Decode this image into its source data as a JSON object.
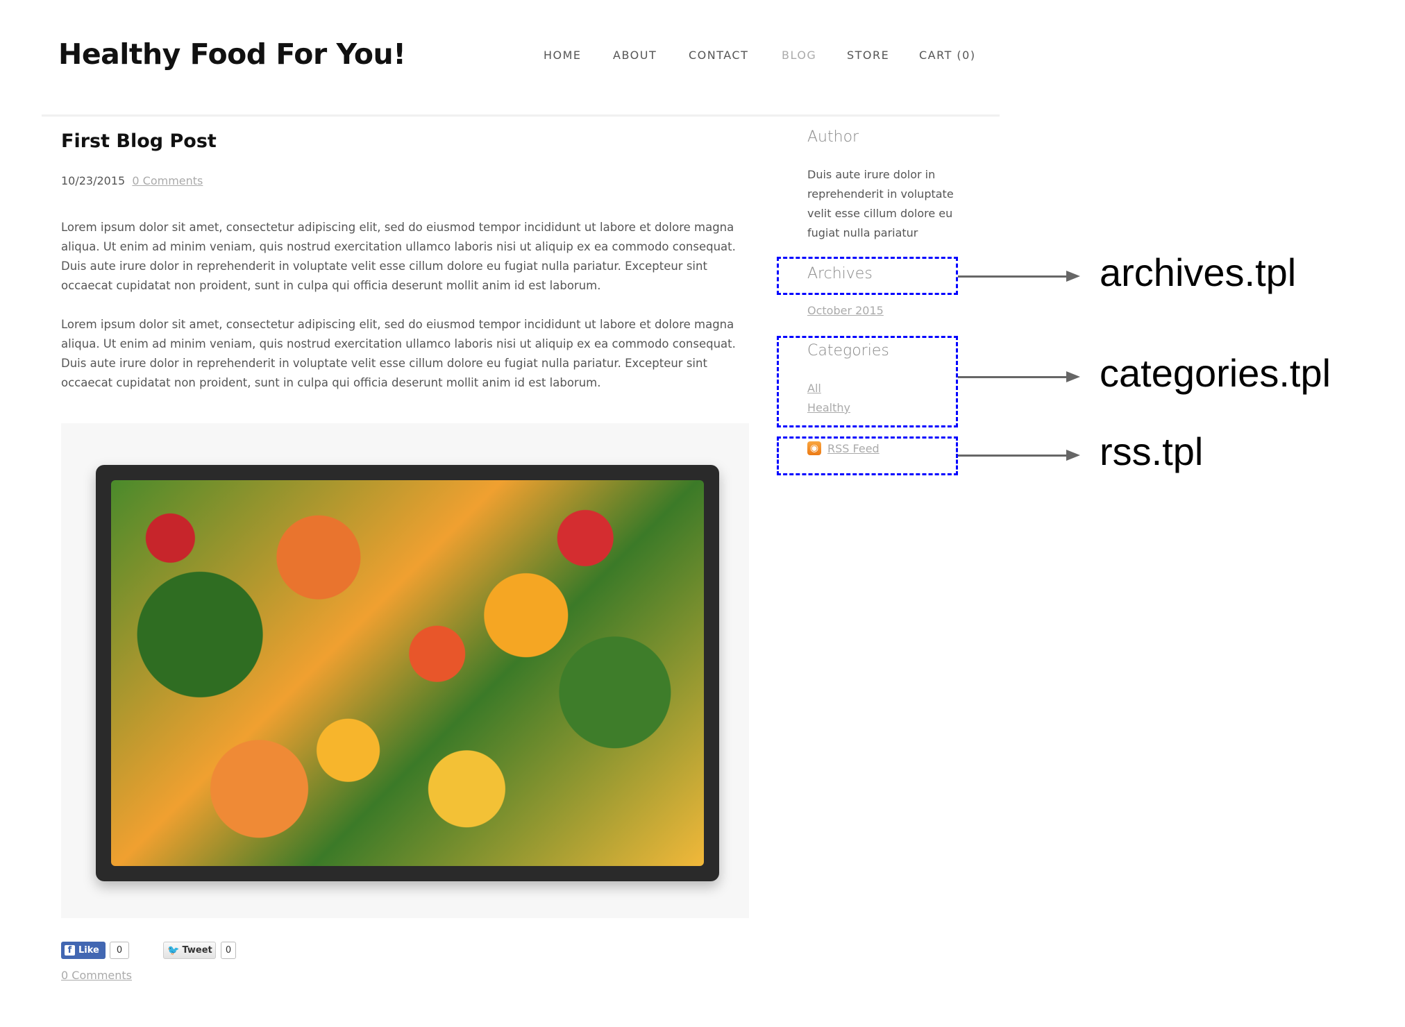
{
  "header": {
    "site_title": "Healthy Food For You!",
    "nav": [
      {
        "label": "HOME",
        "active": false
      },
      {
        "label": "ABOUT",
        "active": false
      },
      {
        "label": "CONTACT",
        "active": false
      },
      {
        "label": "BLOG",
        "active": true
      },
      {
        "label": "STORE",
        "active": false
      },
      {
        "label": "CART (0)",
        "active": false
      }
    ]
  },
  "post": {
    "title": "First Blog Post",
    "date": "10/23/2015",
    "comments_link": "0 Comments",
    "paragraphs": [
      "Lorem ipsum dolor sit amet, consectetur adipiscing elit, sed do eiusmod tempor incididunt ut labore et dolore magna aliqua. Ut enim ad minim veniam, quis nostrud exercitation ullamco laboris nisi ut aliquip ex ea commodo consequat. Duis aute irure dolor in reprehenderit in voluptate velit esse cillum dolore eu fugiat nulla pariatur. Excepteur sint occaecat cupidatat non proident, sunt in culpa qui officia deserunt mollit anim id est laborum.",
      "Lorem ipsum dolor sit amet, consectetur adipiscing elit, sed do eiusmod tempor incididunt ut labore et dolore magna aliqua. Ut enim ad minim veniam, quis nostrud exercitation ullamco laboris nisi ut aliquip ex ea commodo consequat. Duis aute irure dolor in reprehenderit in voluptate velit esse cillum dolore eu fugiat nulla pariatur. Excepteur sint occaecat cupidatat non proident, sunt in culpa qui officia deserunt mollit anim id est laborum."
    ],
    "image_icon": "vegetable-crate-photo",
    "social": {
      "like_label": "Like",
      "like_count": "0",
      "tweet_label": "Tweet",
      "tweet_count": "0"
    },
    "bottom_comments_link": "0 Comments"
  },
  "sidebar": {
    "author_heading": "Author",
    "author_body": "Duis aute irure dolor in reprehenderit in voluptate velit esse cillum dolore eu fugiat nulla pariatur",
    "archives_heading": "Archives",
    "archives": [
      "October 2015"
    ],
    "categories_heading": "Categories",
    "categories": [
      "All",
      "Healthy"
    ],
    "rss_label": "RSS Feed"
  },
  "annotations": {
    "archives": "archives.tpl",
    "categories": "categories.tpl",
    "rss": "rss.tpl",
    "box_color": "#0000ff",
    "arrow_color": "#666666"
  }
}
